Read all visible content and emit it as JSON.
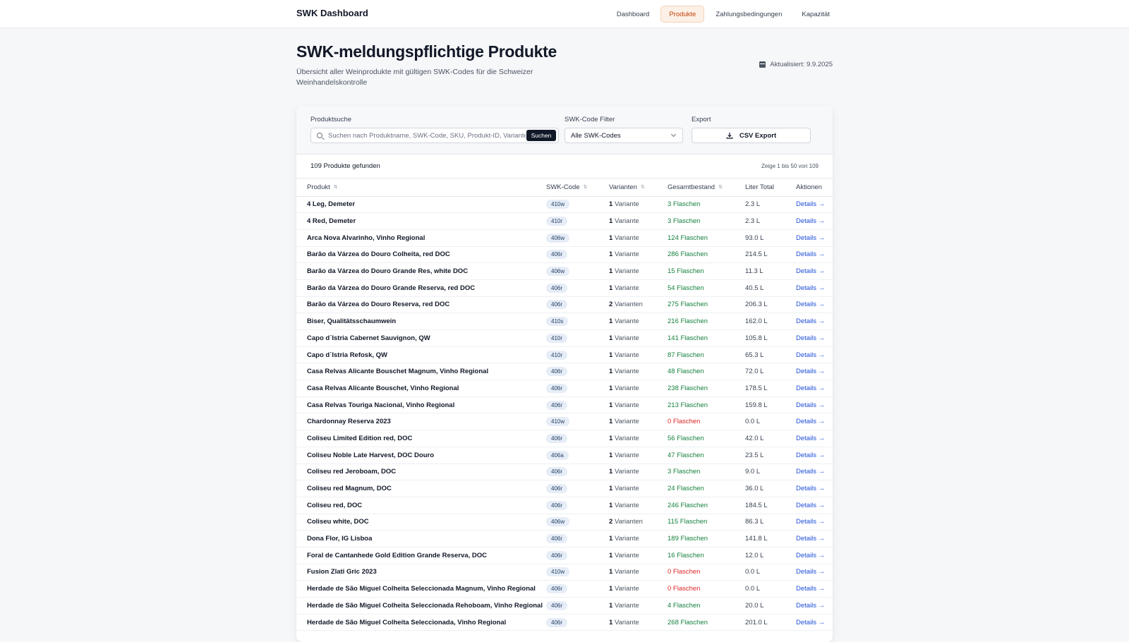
{
  "header": {
    "brand": "SWK Dashboard",
    "nav": [
      "Dashboard",
      "Produkte",
      "Zahlungsbedingungen",
      "Kapazität"
    ],
    "active_nav": "Produkte"
  },
  "page": {
    "title": "SWK-meldungspflichtige Produkte",
    "subtitle": "Übersicht aller Weinprodukte mit gültigen SWK-Codes für die Schweizer Weinhandelskontrolle",
    "updated": "Aktualisiert: 9.9.2025"
  },
  "filters": {
    "search_label": "Produktsuche",
    "search_placeholder": "Suchen nach Produktname, SWK-Code, SKU, Produkt-ID, Varianten",
    "search_button": "Suchen",
    "code_label": "SWK-Code Filter",
    "code_value": "Alle SWK-Codes",
    "export_label": "Export",
    "export_button": "CSV Export"
  },
  "summary": {
    "found": "109 Produkte gefunden",
    "range": "Zeige 1 bis 50 von 109"
  },
  "table": {
    "columns": [
      "Produkt",
      "SWK-Code",
      "Varianten",
      "Gesamtbestand",
      "Liter Total",
      "Aktionen"
    ],
    "details_label": "Details →",
    "rows": [
      {
        "name": "4 Leg, Demeter",
        "code": "410w",
        "variants": "1",
        "variants_word": "Variante",
        "stock": "3 Flaschen",
        "zero": false,
        "liters": "2.3 L"
      },
      {
        "name": "4 Red, Demeter",
        "code": "410r",
        "variants": "1",
        "variants_word": "Variante",
        "stock": "3 Flaschen",
        "zero": false,
        "liters": "2.3 L"
      },
      {
        "name": "Arca Nova Alvarinho, Vinho Regional",
        "code": "406w",
        "variants": "1",
        "variants_word": "Variante",
        "stock": "124 Flaschen",
        "zero": false,
        "liters": "93.0 L"
      },
      {
        "name": "Barão da Várzea do Douro Colheita, red DOC",
        "code": "406r",
        "variants": "1",
        "variants_word": "Variante",
        "stock": "286 Flaschen",
        "zero": false,
        "liters": "214.5 L"
      },
      {
        "name": "Barão da Várzea do Douro Grande Res, white DOC",
        "code": "406w",
        "variants": "1",
        "variants_word": "Variante",
        "stock": "15 Flaschen",
        "zero": false,
        "liters": "11.3 L"
      },
      {
        "name": "Barão da Várzea do Douro Grande Reserva, red DOC",
        "code": "406r",
        "variants": "1",
        "variants_word": "Variante",
        "stock": "54 Flaschen",
        "zero": false,
        "liters": "40.5 L"
      },
      {
        "name": "Barão da Várzea do Douro Reserva, red DOC",
        "code": "406r",
        "variants": "2",
        "variants_word": "Varianten",
        "stock": "275 Flaschen",
        "zero": false,
        "liters": "206.3 L"
      },
      {
        "name": "Biser, Qualitätsschaumwein",
        "code": "410s",
        "variants": "1",
        "variants_word": "Variante",
        "stock": "216 Flaschen",
        "zero": false,
        "liters": "162.0 L"
      },
      {
        "name": "Capo d´Istria Cabernet Sauvignon, QW",
        "code": "410r",
        "variants": "1",
        "variants_word": "Variante",
        "stock": "141 Flaschen",
        "zero": false,
        "liters": "105.8 L"
      },
      {
        "name": "Capo d´Istria Refosk, QW",
        "code": "410r",
        "variants": "1",
        "variants_word": "Variante",
        "stock": "87 Flaschen",
        "zero": false,
        "liters": "65.3 L"
      },
      {
        "name": "Casa Relvas Alicante Bouschet Magnum, Vinho Regional",
        "code": "406r",
        "variants": "1",
        "variants_word": "Variante",
        "stock": "48 Flaschen",
        "zero": false,
        "liters": "72.0 L"
      },
      {
        "name": "Casa Relvas Alicante Bouschet, Vinho Regional",
        "code": "406r",
        "variants": "1",
        "variants_word": "Variante",
        "stock": "238 Flaschen",
        "zero": false,
        "liters": "178.5 L"
      },
      {
        "name": "Casa Relvas Touriga Nacional, Vinho Regional",
        "code": "406r",
        "variants": "1",
        "variants_word": "Variante",
        "stock": "213 Flaschen",
        "zero": false,
        "liters": "159.8 L"
      },
      {
        "name": "Chardonnay Reserva 2023",
        "code": "410w",
        "variants": "1",
        "variants_word": "Variante",
        "stock": "0 Flaschen",
        "zero": true,
        "liters": "0.0 L"
      },
      {
        "name": "Coliseu Limited Edition red, DOC",
        "code": "406r",
        "variants": "1",
        "variants_word": "Variante",
        "stock": "56 Flaschen",
        "zero": false,
        "liters": "42.0 L"
      },
      {
        "name": "Coliseu Noble Late Harvest, DOC Douro",
        "code": "406a",
        "variants": "1",
        "variants_word": "Variante",
        "stock": "47 Flaschen",
        "zero": false,
        "liters": "23.5 L"
      },
      {
        "name": "Coliseu red Jeroboam, DOC",
        "code": "406r",
        "variants": "1",
        "variants_word": "Variante",
        "stock": "3 Flaschen",
        "zero": false,
        "liters": "9.0 L"
      },
      {
        "name": "Coliseu red Magnum, DOC",
        "code": "406r",
        "variants": "1",
        "variants_word": "Variante",
        "stock": "24 Flaschen",
        "zero": false,
        "liters": "36.0 L"
      },
      {
        "name": "Coliseu red, DOC",
        "code": "406r",
        "variants": "1",
        "variants_word": "Variante",
        "stock": "246 Flaschen",
        "zero": false,
        "liters": "184.5 L"
      },
      {
        "name": "Coliseu white, DOC",
        "code": "406w",
        "variants": "2",
        "variants_word": "Varianten",
        "stock": "115 Flaschen",
        "zero": false,
        "liters": "86.3 L"
      },
      {
        "name": "Dona Flor, IG Lisboa",
        "code": "406r",
        "variants": "1",
        "variants_word": "Variante",
        "stock": "189 Flaschen",
        "zero": false,
        "liters": "141.8 L"
      },
      {
        "name": "Foral de Cantanhede Gold Edition Grande Reserva, DOC",
        "code": "406r",
        "variants": "1",
        "variants_word": "Variante",
        "stock": "16 Flaschen",
        "zero": false,
        "liters": "12.0 L"
      },
      {
        "name": "Fusion Zlati Gric 2023",
        "code": "410w",
        "variants": "1",
        "variants_word": "Variante",
        "stock": "0 Flaschen",
        "zero": true,
        "liters": "0.0 L"
      },
      {
        "name": "Herdade de São Miguel Colheita Seleccionada Magnum, Vinho Regional",
        "code": "406r",
        "variants": "1",
        "variants_word": "Variante",
        "stock": "0 Flaschen",
        "zero": true,
        "liters": "0.0 L"
      },
      {
        "name": "Herdade de São Miguel Colheita Seleccionada Rehoboam, Vinho Regional",
        "code": "406r",
        "variants": "1",
        "variants_word": "Variante",
        "stock": "4 Flaschen",
        "zero": false,
        "liters": "20.0 L"
      },
      {
        "name": "Herdade de São Miguel Colheita Seleccionada, Vinho Regional",
        "code": "406r",
        "variants": "1",
        "variants_word": "Variante",
        "stock": "268 Flaschen",
        "zero": false,
        "liters": "201.0 L"
      }
    ]
  },
  "colors": {
    "accent": "#c2410c",
    "stock_ok": "#15803d",
    "stock_zero": "#dc2626",
    "link": "#1d4ed8"
  }
}
